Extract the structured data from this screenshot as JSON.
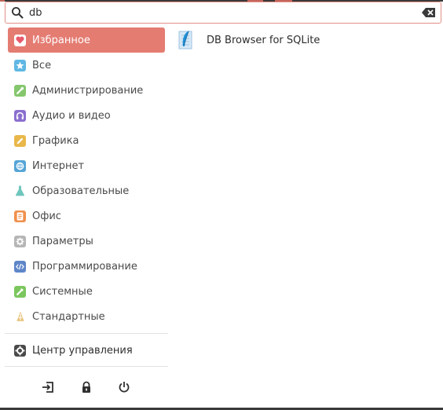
{
  "search": {
    "value": "db",
    "placeholder": ""
  },
  "categories": [
    {
      "label": "Избранное",
      "icon": "heart-icon",
      "color": "#e85a6a",
      "active": true
    },
    {
      "label": "Все",
      "icon": "star-icon",
      "color": "#5fb8e3"
    },
    {
      "label": "Администрирование",
      "icon": "admin-icon",
      "color": "#86c76d"
    },
    {
      "label": "Аудио и видео",
      "icon": "headphones-icon",
      "color": "#8b6fcf"
    },
    {
      "label": "Графика",
      "icon": "pencil-icon",
      "color": "#e8b84a"
    },
    {
      "label": "Интернет",
      "icon": "globe-icon",
      "color": "#54a5d6"
    },
    {
      "label": "Образовательные",
      "icon": "flask-icon",
      "color": "#6fc6bd"
    },
    {
      "label": "Офис",
      "icon": "document-icon",
      "color": "#f0904d"
    },
    {
      "label": "Параметры",
      "icon": "gear-icon",
      "color": "#b5b5b5"
    },
    {
      "label": "Программирование",
      "icon": "code-icon",
      "color": "#5f86c8"
    },
    {
      "label": "Системные",
      "icon": "system-icon",
      "color": "#7cc65e"
    },
    {
      "label": "Стандартные",
      "icon": "accessories-icon",
      "color": "#e7c47e"
    }
  ],
  "control_center": {
    "label": "Центр управления",
    "icon": "gear-icon",
    "color": "#4a4a4a"
  },
  "actions": [
    {
      "name": "logout-button",
      "icon": "logout-icon"
    },
    {
      "name": "lock-button",
      "icon": "lock-icon"
    },
    {
      "name": "power-button",
      "icon": "power-icon"
    }
  ],
  "results": [
    {
      "label": "DB Browser for SQLite",
      "icon": "sqlite-feather-icon"
    }
  ],
  "accent": "#e47c72"
}
